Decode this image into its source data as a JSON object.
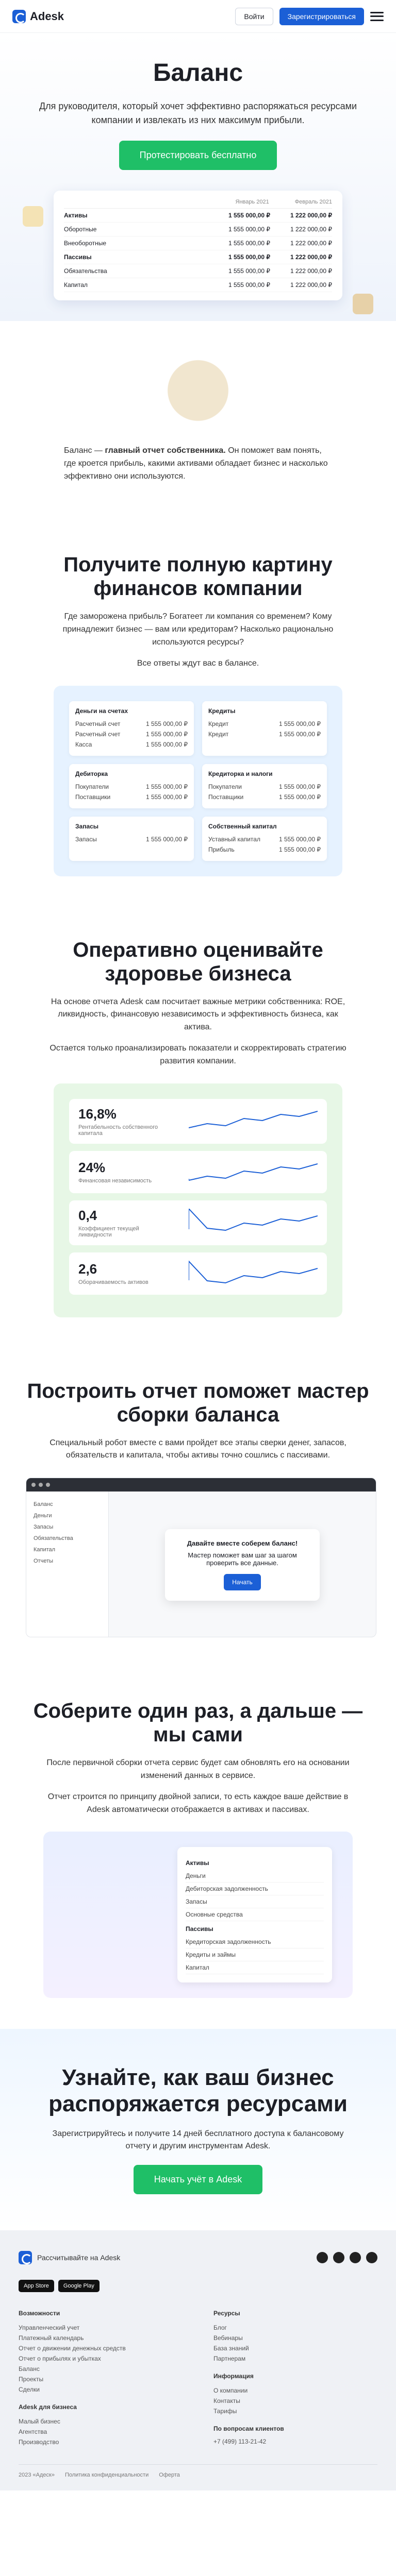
{
  "header": {
    "logo": "Adesk",
    "login": "Войти",
    "signup": "Зарегистрироваться"
  },
  "hero": {
    "title": "Баланс",
    "lead": "Для руководителя, который хочет эффективно распоряжаться ресурсами компании и извлекать из них максимум прибыли.",
    "cta": "Протестировать бесплатно",
    "card": {
      "cols": [
        "Январь 2021",
        "Февраль 2021"
      ],
      "rows": [
        {
          "label": "Активы",
          "v1": "1 555 000,00 ₽",
          "v2": "1 222 000,00 ₽",
          "bold": true
        },
        {
          "label": "Оборотные",
          "v1": "1 555 000,00 ₽",
          "v2": "1 222 000,00 ₽",
          "bold": false
        },
        {
          "label": "Внеоборотные",
          "v1": "1 555 000,00 ₽",
          "v2": "1 222 000,00 ₽",
          "bold": false
        },
        {
          "label": "Пассивы",
          "v1": "1 555 000,00 ₽",
          "v2": "1 222 000,00 ₽",
          "bold": true
        },
        {
          "label": "Обязательства",
          "v1": "1 555 000,00 ₽",
          "v2": "1 222 000,00 ₽",
          "bold": false
        },
        {
          "label": "Капитал",
          "v1": "1 555 000,00 ₽",
          "v2": "1 222 000,00 ₽",
          "bold": false
        }
      ]
    }
  },
  "intro": {
    "lead_bold": "главный отчет собственника.",
    "lead_start": "Баланс —",
    "lead_end": "Он поможет вам понять, где кроется прибыль, какими активами обладает бизнес и насколько эффективно они используются."
  },
  "s1": {
    "title": "Получите полную картину финансов компании",
    "p1": "Где заморожена прибыль? Богатеет ли компания со временем? Кому принадлежит бизнес — вам или кредиторам? Насколько рационально используются ресурсы?",
    "p2": "Все ответы ждут вас в балансе.",
    "cards": [
      {
        "title": "Деньги на счетах",
        "rows": [
          [
            "Расчетный счет",
            "1 555 000,00 ₽"
          ],
          [
            "Расчетный счет",
            "1 555 000,00 ₽"
          ],
          [
            "Касса",
            "1 555 000,00 ₽"
          ]
        ]
      },
      {
        "title": "Кредиты",
        "rows": [
          [
            "Кредит",
            "1 555 000,00 ₽"
          ],
          [
            "Кредит",
            "1 555 000,00 ₽"
          ]
        ]
      },
      {
        "title": "Дебиторка",
        "rows": [
          [
            "Покупатели",
            "1 555 000,00 ₽"
          ],
          [
            "Поставщики",
            "1 555 000,00 ₽"
          ]
        ]
      },
      {
        "title": "Кредиторка и налоги",
        "rows": [
          [
            "Покупатели",
            "1 555 000,00 ₽"
          ],
          [
            "Поставщики",
            "1 555 000,00 ₽"
          ]
        ]
      },
      {
        "title": "Запасы",
        "rows": [
          [
            "Запасы",
            "1 555 000,00 ₽"
          ]
        ]
      },
      {
        "title": "Собственный капитал",
        "rows": [
          [
            "Уставный капитал",
            "1 555 000,00 ₽"
          ],
          [
            "Прибыль",
            "1 555 000,00 ₽"
          ]
        ]
      }
    ]
  },
  "s2": {
    "title": "Оперативно оценивайте здоровье бизнеса",
    "p1": "На основе отчета Adesk сам посчитает важные метрики собственника: ROE, ликвидность, финансовую независимость и эффективность бизнеса, как актива.",
    "p2": "Остается только проанализировать показатели и скорректировать стратегию развития компании.",
    "metrics": [
      {
        "value": "16,8%",
        "caption": "Рентабельность собственного капитала"
      },
      {
        "value": "24%",
        "caption": "Финансовая независимость"
      },
      {
        "value": "0,4",
        "caption": "Коэффициент текущей ликвидности"
      },
      {
        "value": "2,6",
        "caption": "Оборачиваемость активов"
      }
    ]
  },
  "s3": {
    "title": "Построить отчет поможет мастер сборки баланса",
    "p1": "Специальный робот вместе с вами пройдет все этапы сверки денег, запасов, обязательств и капитала, чтобы активы точно сошлись с пассивами.",
    "side": [
      "Баланс",
      "Деньги",
      "Запасы",
      "Обязательства",
      "Капитал",
      "Отчеты"
    ],
    "wizard_title": "Давайте вместе соберем баланс!",
    "wizard_text": "Мастер поможет вам шаг за шагом проверить все данные.",
    "wizard_btn": "Начать"
  },
  "s4": {
    "title": "Соберите один раз, а дальше — мы сами",
    "p1": "После первичной сборки отчета сервис будет сам обновлять его на основании изменений данных в сервисе.",
    "p2": "Отчет строится по принципу двойной записи, то есть каждое ваше действие в Adesk автоматически отображается в активах и пассивах.",
    "assets_title": "Активы",
    "assets": [
      "Деньги",
      "Дебиторская задолженность",
      "Запасы",
      "Основные средства"
    ],
    "liab_title": "Пассивы",
    "liabs": [
      "Кредиторская задолженность",
      "Кредиты и займы",
      "Капитал"
    ]
  },
  "cta": {
    "title": "Узнайте, как ваш бизнес распоряжается ресурсами",
    "text": "Зарегистрируйтесь и получите 14 дней бесплатного доступа к балансовому отчету и другим инструментам Adesk.",
    "btn": "Начать учёт в Adesk"
  },
  "footer": {
    "brand": "Рассчитывайте на Adesk",
    "apps": [
      "App Store",
      "Google Play"
    ],
    "col1_title": "Возможности",
    "col1": [
      "Управленческий учет",
      "Платежный календарь",
      "Отчет о движении денежных средств",
      "Отчет о прибылях и убытках",
      "Баланс",
      "Проекты",
      "Сделки"
    ],
    "col1b_title": "Adesk для бизнеса",
    "col1b": [
      "Малый бизнес",
      "Агентства",
      "Производство"
    ],
    "col2_title": "Ресурсы",
    "col2": [
      "Блог",
      "Вебинары",
      "База знаний",
      "Партнерам"
    ],
    "col2b_title": "Информация",
    "col2b": [
      "О компании",
      "Контакты",
      "Тарифы"
    ],
    "col2c_title": "По вопросам клиентов",
    "phone": "+7 (499) 113-21-42",
    "bottom": [
      "2023 «Адеск»",
      "Политика конфиденциальности",
      "Оферта"
    ]
  }
}
